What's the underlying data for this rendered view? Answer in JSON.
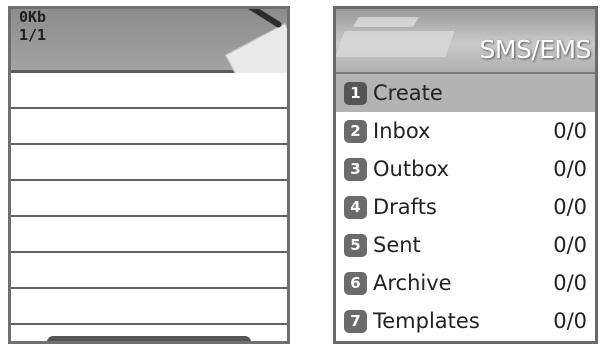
{
  "left_screen": {
    "size_text": "0Kb",
    "page_text": "1/1",
    "line_count": 8
  },
  "right_screen": {
    "title": "SMS/EMS",
    "items": [
      {
        "number": "1",
        "label": "Create",
        "count": "",
        "selected": true
      },
      {
        "number": "2",
        "label": "Inbox",
        "count": "0/0",
        "selected": false
      },
      {
        "number": "3",
        "label": "Outbox",
        "count": "0/0",
        "selected": false
      },
      {
        "number": "4",
        "label": "Drafts",
        "count": "0/0",
        "selected": false
      },
      {
        "number": "5",
        "label": "Sent",
        "count": "0/0",
        "selected": false
      },
      {
        "number": "6",
        "label": "Archive",
        "count": "0/0",
        "selected": false
      },
      {
        "number": "7",
        "label": "Templates",
        "count": "0/0",
        "selected": false
      }
    ]
  },
  "colors": {
    "header_gray": "#9a9a9a",
    "selected_row": "#b3b3b3",
    "badge_gray": "#6b6b6b"
  }
}
